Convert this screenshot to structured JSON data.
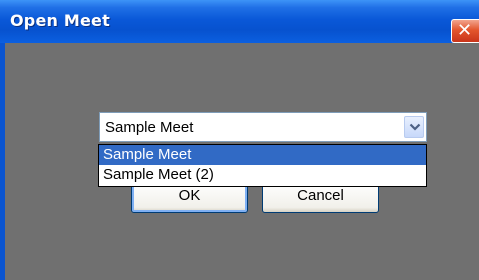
{
  "window": {
    "title": "Open Meet"
  },
  "title_bar": {
    "close_glyph": "✕"
  },
  "combo": {
    "selected_value": "Sample Meet"
  },
  "dropdown": {
    "options": [
      "Sample Meet",
      "Sample Meet (2)"
    ],
    "highlighted_index": 0
  },
  "buttons": {
    "ok_label": "OK",
    "cancel_label": "Cancel"
  },
  "colors": {
    "title_bar": "#0752cf",
    "body": "#707070",
    "highlight": "#316ac5",
    "close": "#e3562d"
  }
}
